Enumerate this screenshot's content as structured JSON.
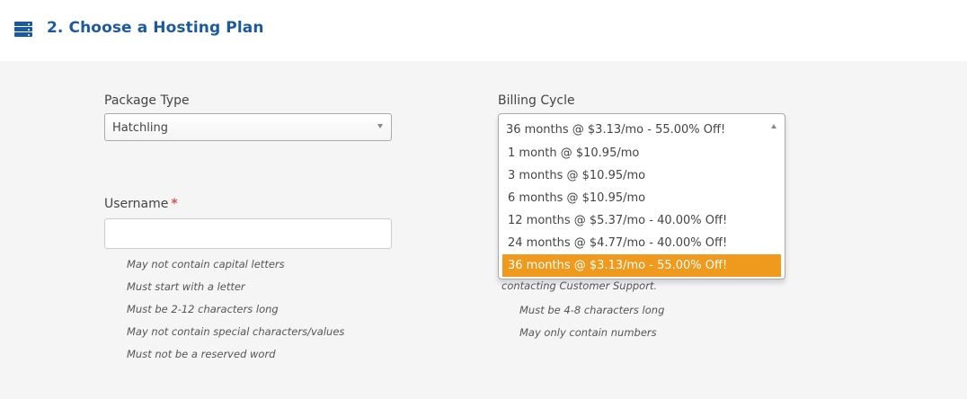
{
  "header": {
    "icon": "server-icon",
    "title": "2. Choose a Hosting Plan",
    "accent_color": "#1d5a9c"
  },
  "package_type": {
    "label": "Package Type",
    "value": "Hatchling"
  },
  "billing_cycle": {
    "label": "Billing Cycle",
    "value": "36 months @ $3.13/mo - 55.00% Off!",
    "options": [
      "1 month @ $10.95/mo",
      "3 months @ $10.95/mo",
      "6 months @ $10.95/mo",
      "12 months @ $5.37/mo - 40.00% Off!",
      "24 months @ $4.77/mo - 40.00% Off!",
      "36 months @ $3.13/mo - 55.00% Off!"
    ],
    "highlight_color": "#ef9a1c"
  },
  "username": {
    "label": "Username",
    "required_mark": "*",
    "value": "",
    "rules": [
      "May not contain capital letters",
      "Must start with a letter",
      "Must be 2-12 characters long",
      "May not contain special characters/values",
      "Must not be a reserved word"
    ]
  },
  "pin": {
    "note": "contacting Customer Support.",
    "rules": [
      "Must be 4-8 characters long",
      "May only contain numbers"
    ]
  }
}
